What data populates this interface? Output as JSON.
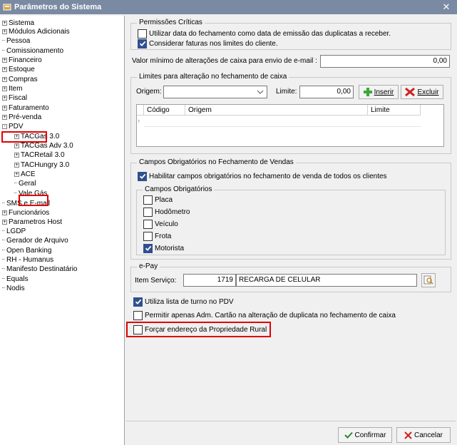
{
  "window": {
    "title": "Parâmetros do Sistema",
    "close_glyph": "✕"
  },
  "tree": {
    "items": [
      {
        "label": "Sistema",
        "expander": "+",
        "level": 0
      },
      {
        "label": "Módulos Adicionais",
        "expander": "+",
        "level": 0
      },
      {
        "label": "Pessoa",
        "expander": "",
        "level": 0
      },
      {
        "label": "Comissionamento",
        "expander": "",
        "level": 0
      },
      {
        "label": "Financeiro",
        "expander": "+",
        "level": 0
      },
      {
        "label": "Estoque",
        "expander": "+",
        "level": 0
      },
      {
        "label": "Compras",
        "expander": "+",
        "level": 0
      },
      {
        "label": "Item",
        "expander": "+",
        "level": 0
      },
      {
        "label": "Fiscal",
        "expander": "+",
        "level": 0
      },
      {
        "label": "Faturamento",
        "expander": "+",
        "level": 0
      },
      {
        "label": "Pré-venda",
        "expander": "+",
        "level": 0
      },
      {
        "label": "PDV",
        "expander": "-",
        "level": 0
      },
      {
        "label": "TACGas 3.0",
        "expander": "+",
        "level": 1
      },
      {
        "label": "TACGas Adv 3.0",
        "expander": "+",
        "level": 1
      },
      {
        "label": "TACRetail 3.0",
        "expander": "+",
        "level": 1
      },
      {
        "label": "TACHungry 3.0",
        "expander": "+",
        "level": 1
      },
      {
        "label": "ACE",
        "expander": "+",
        "level": 1
      },
      {
        "label": "Geral",
        "expander": "",
        "level": 1
      },
      {
        "label": "Vale Gás",
        "expander": "",
        "level": 1
      },
      {
        "label": "SMS e E-mail",
        "expander": "",
        "level": 0
      },
      {
        "label": "Funcionários",
        "expander": "+",
        "level": 0
      },
      {
        "label": "Parametros Host",
        "expander": "+",
        "level": 0
      },
      {
        "label": "LGDP",
        "expander": "",
        "level": 0
      },
      {
        "label": "Gerador de Arquivo",
        "expander": "",
        "level": 0
      },
      {
        "label": "Open Banking",
        "expander": "",
        "level": 0
      },
      {
        "label": "RH - Humanus",
        "expander": "",
        "level": 0
      },
      {
        "label": "Manifesto Destinatário",
        "expander": "",
        "level": 0
      },
      {
        "label": "Equals",
        "expander": "",
        "level": 0
      },
      {
        "label": "Nodis",
        "expander": "",
        "level": 0
      }
    ]
  },
  "permissoes": {
    "legend": "Permissões Críticas",
    "opt1": "Utilizar data do fechamento como data de emissão das duplicatas a receber.",
    "opt1_checked": false,
    "opt2": "Considerar faturas nos limites do cliente.",
    "opt2_checked": true
  },
  "valor_minimo": {
    "label": "Valor mínimo de alterações de caixa para envio de e-mail :",
    "value": "0,00"
  },
  "limites": {
    "legend": "Limites para alteração no fechamento de caixa",
    "origem_label": "Origem:",
    "origem_value": "",
    "limite_label": "Limite:",
    "limite_value": "0,00",
    "inserir": "Inserir",
    "excluir": "Excluir",
    "columns": [
      "Código",
      "Origem",
      "Limite"
    ]
  },
  "campos": {
    "legend": "Campos Obrigatórios no Fechamento de Vendas",
    "habilitar": "Habilitar campos obrigatórios no fechamento de venda de todos os clientes",
    "habilitar_checked": true,
    "sub_legend": "Campos Obrigatórios",
    "fields": [
      {
        "label": "Placa",
        "checked": false
      },
      {
        "label": "Hodômetro",
        "checked": false
      },
      {
        "label": "Veículo",
        "checked": false
      },
      {
        "label": "Frota",
        "checked": false
      },
      {
        "label": "Motorista",
        "checked": true
      }
    ]
  },
  "epay": {
    "legend": "e-Pay",
    "item_label": "Item Serviço:",
    "item_code": "1719",
    "item_desc": "RECARGA DE CELULAR"
  },
  "options": {
    "turno": "Utiliza lista de turno no PDV",
    "turno_checked": true,
    "adm_cartao": "Permitir apenas Adm. Cartão na alteração de duplicata no fechamento de caixa",
    "adm_cartao_checked": false,
    "forcar": "Forçar endereço da Propriedade Rural",
    "forcar_checked": false
  },
  "footer": {
    "confirmar": "Confirmar",
    "cancelar": "Cancelar"
  },
  "colors": {
    "title_bar": "#7a8aa3",
    "highlight": "#e00000",
    "check": "#2f4f8f"
  }
}
